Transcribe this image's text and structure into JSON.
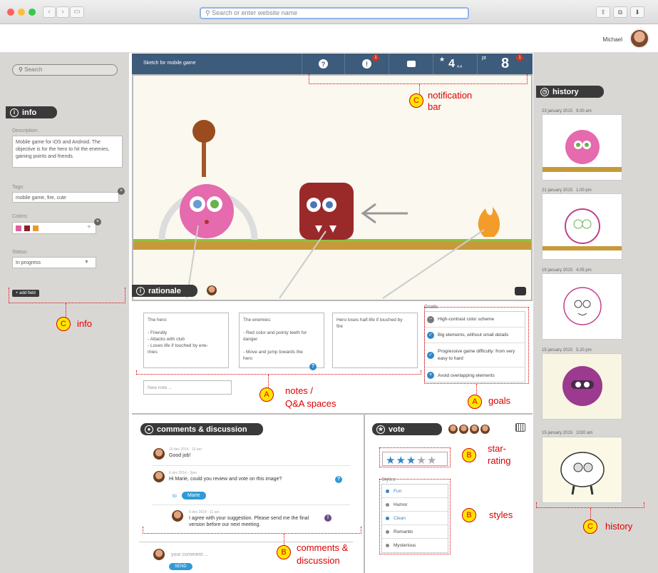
{
  "browser": {
    "url_placeholder": "Search or enter website name",
    "colors": {
      "close": "#fc605c",
      "minimize": "#fdbc40",
      "maximize": "#34c84a"
    }
  },
  "header": {
    "user_name": "Michael"
  },
  "left": {
    "search_placeholder": "Search",
    "info_title": "info",
    "description_label": "Description:",
    "description": "Mobile game for iOS and Android. The objective is for the hero to hit the enemies, gaining points and friends.",
    "tags_label": "Tags:",
    "tags": "mobile game, fire, cute",
    "colors_label": "Colors:",
    "color_swatches": [
      "#e0609a",
      "#8b1f2a",
      "#e89a2a"
    ],
    "add_color": "+",
    "status_label": "Status:",
    "status_value": "In progress",
    "add_field": "+ add field"
  },
  "toolbar": {
    "title": "Sketch for mobile game",
    "help_icon": "?",
    "alert_icon": "!",
    "alert_badge": "1",
    "chat_icon": "chat",
    "rating_value": "4",
    "rating_sub": "4.4",
    "points_label": "pt",
    "points_value": "8",
    "points_badge": "1",
    "bg": "#3d5b7a"
  },
  "rationale": {
    "title": "rationale",
    "notes": [
      {
        "title": "The hero:",
        "lines": [
          "- Friendly",
          "- Attacks with club",
          "- Loses life if touched by ene-",
          "mies"
        ]
      },
      {
        "title": "The enemies:",
        "lines": [
          "- Red color and pointy teeth for",
          "danger",
          "",
          "- Move and jump towards the",
          "hero"
        ]
      },
      {
        "title": "Hero loses half-life if touched by",
        "lines": [
          "fire"
        ]
      }
    ],
    "new_note_placeholder": "New note ...",
    "goals_label": "Goals:",
    "goals": [
      {
        "text": "High-contrast color scheme",
        "state": "minus"
      },
      {
        "text": "Big elements, without small details",
        "state": "check"
      },
      {
        "text": "Progressive game difficulty: from very easy to hard",
        "state": "check"
      },
      {
        "text": "Avoid overlapping elements",
        "state": "x"
      }
    ]
  },
  "comments": {
    "title": "comments & discussion",
    "items": [
      {
        "meta": "10 dec 2014 - 10 am",
        "text": "Good job!"
      },
      {
        "meta": "6 dec 2014 - 3pm",
        "text": "Hi Marie, could you review and vote on this image?",
        "to_label": "to",
        "to_name": "Marie"
      },
      {
        "meta": "6 dec 2014 - 11 am",
        "text": "I agree with your suggestion. Please send me the final version before our next meeting."
      }
    ],
    "input_placeholder": "your comment ...",
    "send": "SEND"
  },
  "vote": {
    "title": "vote",
    "stars_filled": 3,
    "stars_total": 5,
    "styles_label": "Styles:",
    "styles": [
      {
        "name": "Fun",
        "color": "#2f86c9"
      },
      {
        "name": "Humor",
        "color": "#888888"
      },
      {
        "name": "Clean",
        "color": "#2f86c9"
      },
      {
        "name": "Romantic",
        "color": "#888888"
      },
      {
        "name": "Mysterious",
        "color": "#888888"
      }
    ]
  },
  "history": {
    "title": "history",
    "items": [
      {
        "date": "23 january 2015",
        "time": "9.00 am"
      },
      {
        "date": "21 january 2015",
        "time": "1.00 pm"
      },
      {
        "date": "19 january 2015",
        "time": "4.05 pm"
      },
      {
        "date": "15 january 2015",
        "time": "5.20 pm"
      },
      {
        "date": "15 january 2015",
        "time": "1020 am"
      }
    ]
  },
  "annotations": {
    "notification": {
      "letter": "C",
      "label_1": "notification",
      "label_2": "bar"
    },
    "info": {
      "letter": "C",
      "label": "info"
    },
    "notes": {
      "letter": "A",
      "label_1": "notes /",
      "label_2": "Q&A spaces"
    },
    "goals": {
      "letter": "A",
      "label": "goals"
    },
    "star_rating": {
      "letter": "B",
      "label_1": "star-",
      "label_2": "rating"
    },
    "styles": {
      "letter": "B",
      "label": "styles"
    },
    "comments": {
      "letter": "B",
      "label_1": "comments &",
      "label_2": "discussion"
    },
    "history": {
      "letter": "C",
      "label": "history"
    }
  }
}
